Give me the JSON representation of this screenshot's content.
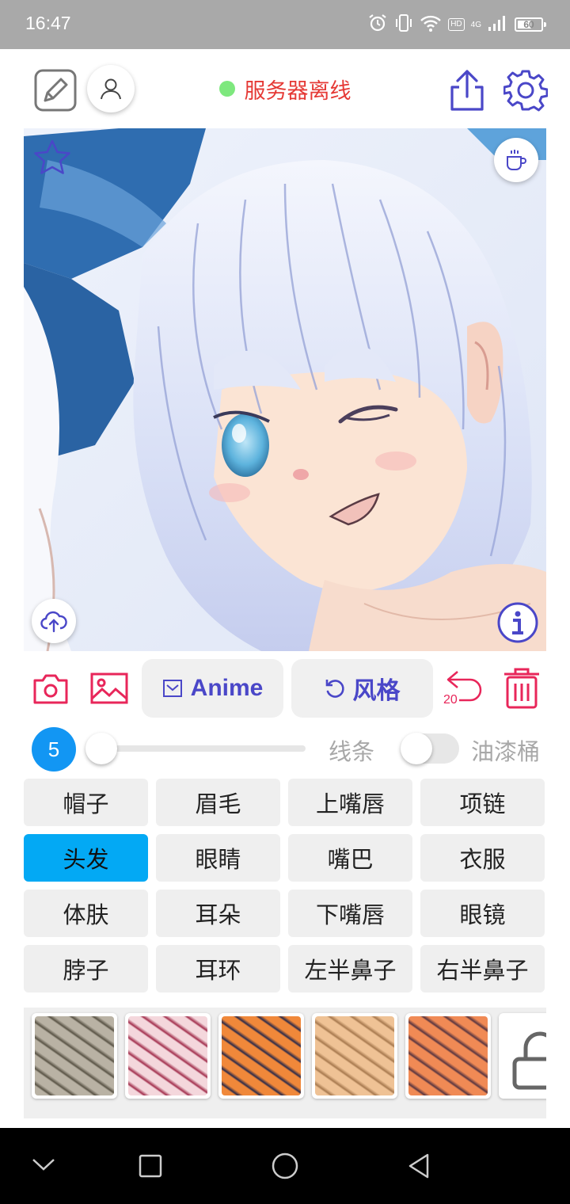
{
  "status_bar": {
    "time": "16:47",
    "network_badge": "HD",
    "network_type": "4G",
    "battery": "60",
    "battery_fraction": 0.6,
    "icons": [
      "alarm-icon",
      "vibrate-icon",
      "wifi-icon",
      "signal-icon",
      "battery-icon"
    ]
  },
  "header": {
    "server_status": "服务器离线",
    "server_status_color": "#e53935",
    "status_dot_color": "#7ee87e",
    "icons": [
      "edit-canvas-icon",
      "user-icon",
      "share-icon",
      "settings-icon"
    ]
  },
  "image": {
    "icons": [
      "star-icon",
      "coffee-icon",
      "cloud-upload-icon",
      "info-icon"
    ]
  },
  "toolbar": {
    "anime_label": "Anime",
    "style_label": "风格",
    "undo_count": "20",
    "icons": [
      "camera-icon",
      "gallery-icon",
      "mail-icon",
      "rotate-icon",
      "undo-icon",
      "trash-icon"
    ]
  },
  "brush": {
    "size": "5",
    "slider_fraction": 0,
    "line_label": "线条",
    "bucket_label": "油漆桶",
    "bucket_enabled": false
  },
  "parts": {
    "items": [
      "帽子",
      "眉毛",
      "上嘴唇",
      "项链",
      "头发",
      "眼睛",
      "嘴巴",
      "衣服",
      "体肤",
      "耳朵",
      "下嘴唇",
      "眼镜",
      "脖子",
      "耳环",
      "左半鼻子",
      "右半鼻子"
    ],
    "selected": "头发"
  },
  "palette": {
    "swatches": [
      {
        "name": "gray-texture-swatch",
        "base": "#b9b2a4",
        "stroke": "#5a5446"
      },
      {
        "name": "pink-texture-swatch",
        "base": "#f4d7dc",
        "stroke": "#a3314f"
      },
      {
        "name": "orange-texture-swatch",
        "base": "#f0883a",
        "stroke": "#2d2b4a"
      },
      {
        "name": "beige-texture-swatch",
        "base": "#efc295",
        "stroke": "#a87a4f"
      },
      {
        "name": "coral-texture-swatch",
        "base": "#f08a55",
        "stroke": "#5a3640"
      }
    ],
    "lock_icon": "lock-icon"
  },
  "nav_bar": {
    "icons": [
      "nav-collapse-icon",
      "nav-recents-icon",
      "nav-home-icon",
      "nav-back-icon"
    ]
  },
  "colors": {
    "accent_purple": "#4a47c8",
    "accent_pink": "#e8265a",
    "selected_part": "#03a9f4",
    "size_badge": "#1296f3"
  }
}
